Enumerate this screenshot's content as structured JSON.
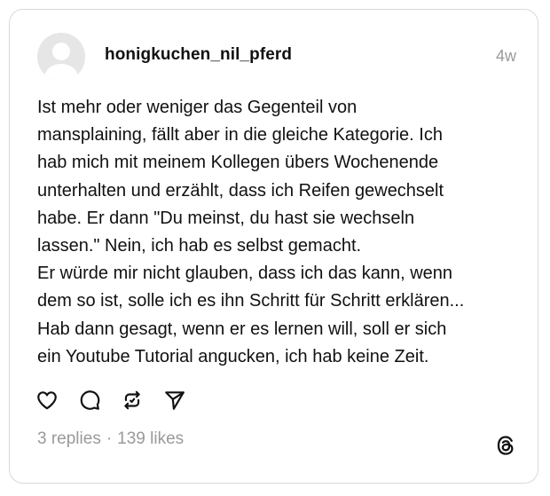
{
  "post": {
    "username": "honigkuchen_nil_pferd",
    "timestamp": "4w",
    "avatar_icon": "default-avatar-icon",
    "body_lines": [
      "Ist mehr oder weniger das Gegenteil von",
      "mansplaining, fällt aber in die gleiche Kategorie. Ich",
      "hab mich mit meinem Kollegen übers Wochenende",
      "unterhalten und erzählt, dass ich Reifen gewechselt",
      "habe. Er dann \"Du meinst, du hast sie wechseln",
      "lassen.\" Nein, ich hab es selbst gemacht.",
      "Er würde mir nicht glauben, dass ich das kann, wenn",
      "dem so ist, solle ich es ihn Schritt für Schritt erklären...",
      "Hab dann gesagt, wenn er es lernen will, soll er sich",
      "ein Youtube Tutorial angucken, ich hab keine Zeit."
    ],
    "actions": [
      "heart-icon",
      "comment-icon",
      "repost-icon",
      "share-icon"
    ],
    "stats": {
      "replies": "3 replies",
      "separator": "·",
      "likes": "139 likes"
    },
    "brand_icon": "threads-logo-icon"
  },
  "colors": {
    "text": "#111111",
    "muted": "#9a9a9a",
    "border": "#d9d9d9",
    "avatar_bg": "#e6e6e6",
    "avatar_fg": "#ffffff"
  }
}
